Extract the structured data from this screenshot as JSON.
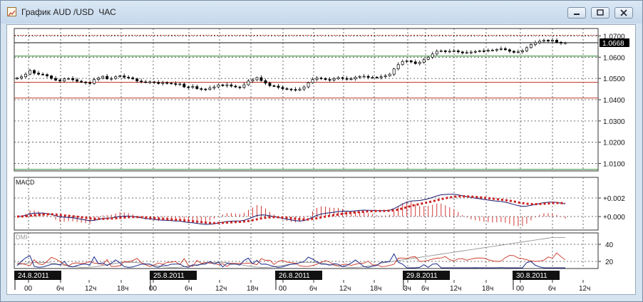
{
  "window": {
    "title": "График AUD /USD  ЧАС",
    "buttons": [
      "minimize",
      "maximize",
      "close"
    ]
  },
  "price_panel": {
    "price_levels": [
      "1.0700",
      "1.0600",
      "1.0500",
      "1.0400",
      "1.0300",
      "1.0200",
      "1.0100"
    ],
    "current_price": "1.0668",
    "range": [
      1.0065,
      1.0735
    ],
    "horizontal_lines": [
      {
        "price": 1.0703,
        "color": "#c0392b",
        "style": "dotted"
      },
      {
        "price": 1.0668,
        "color": "#111111",
        "style": "solid"
      },
      {
        "price": 1.0605,
        "color": "#2e8b2e",
        "style": "solid"
      },
      {
        "price": 1.0482,
        "color": "#c0392b",
        "style": "solid"
      },
      {
        "price": 1.0408,
        "color": "#c0392b",
        "style": "solid"
      },
      {
        "price": 1.0072,
        "color": "#2e8b2e",
        "style": "solid"
      }
    ]
  },
  "macd_panel": {
    "label": "MACD",
    "levels": [
      "+0.002",
      "+0.000"
    ]
  },
  "dmi_panel": {
    "label": "DMI",
    "levels": [
      "40",
      "20"
    ]
  },
  "time_axis": {
    "date_labels": [
      "24.8.2011",
      "25.8.2011",
      "26.8.2011",
      "29.8.2011",
      "30.8.2011"
    ],
    "hour_labels": [
      "00",
      "6ч",
      "12ч",
      "18ч",
      "00",
      "6ч",
      "12ч",
      "18ч",
      "00",
      "6ч",
      "12ч",
      "18ч",
      "3ч",
      "6ч",
      "12ч",
      "18ч",
      "00",
      "6ч",
      "12ч"
    ]
  },
  "colors": {
    "background": "#ffffff",
    "candle": "#000000",
    "macd_signal": "#cc2222",
    "macd_line": "#1a1a6e",
    "dmi_plus": "#1a2a8a",
    "dmi_minus": "#cc3322",
    "adx": "#888888",
    "grid": "#444444"
  },
  "chart_data": {
    "type": "candlestick",
    "title": "",
    "symbol": "AUD/USD",
    "timeframe": "H1",
    "ylim": [
      1.0065,
      1.0735
    ],
    "close": [
      1.0502,
      1.0508,
      1.052,
      1.0538,
      1.0525,
      1.052,
      1.0518,
      1.0512,
      1.05,
      1.0492,
      1.0488,
      1.0498,
      1.05,
      1.0494,
      1.0487,
      1.0483,
      1.048,
      1.0476,
      1.0495,
      1.0502,
      1.051,
      1.0498,
      1.05,
      1.0508,
      1.0512,
      1.0506,
      1.0503,
      1.0498,
      1.0488,
      1.0484,
      1.0482,
      1.0484,
      1.0481,
      1.0476,
      1.048,
      1.0478,
      1.0476,
      1.0472,
      1.0474,
      1.046,
      1.0458,
      1.0462,
      1.0452,
      1.045,
      1.0448,
      1.0455,
      1.046,
      1.047,
      1.0466,
      1.047,
      1.0464,
      1.046,
      1.0458,
      1.047,
      1.0488,
      1.0494,
      1.0504,
      1.049,
      1.0478,
      1.0466,
      1.0464,
      1.0458,
      1.0452,
      1.045,
      1.0448,
      1.0445,
      1.045,
      1.046,
      1.048,
      1.0495,
      1.0502,
      1.05,
      1.0495,
      1.0492,
      1.0498,
      1.0504,
      1.05,
      1.0496,
      1.0498,
      1.0506,
      1.051,
      1.051,
      1.0505,
      1.0506,
      1.0504,
      1.0508,
      1.0512,
      1.052,
      1.0545,
      1.0565,
      1.058,
      1.0583,
      1.0578,
      1.057,
      1.0576,
      1.059,
      1.06,
      1.0615,
      1.0628,
      1.063,
      1.0626,
      1.0628,
      1.063,
      1.0625,
      1.062,
      1.0622,
      1.0624,
      1.0627,
      1.063,
      1.0629,
      1.0632,
      1.0633,
      1.0637,
      1.064,
      1.0635,
      1.0628,
      1.0623,
      1.0625,
      1.063,
      1.0645,
      1.066,
      1.0668,
      1.0675,
      1.068,
      1.0676,
      1.068,
      1.067,
      1.0666,
      1.0668
    ]
  }
}
